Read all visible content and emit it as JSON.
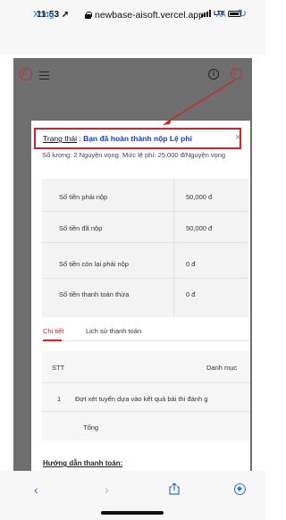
{
  "status_bar": {
    "time": "11:53",
    "carrier": "LTE"
  },
  "browser": {
    "done_label": "Xong",
    "url": "newbase-aisoft.vercel.app",
    "text_size_label": "AA"
  },
  "modal": {
    "status_key": "Trạng thái",
    "status_sep": " : ",
    "status_value": "Bạn đã hoàn thành nộp Lệ phí",
    "close_label": "×",
    "summary": "Số lượng: 2 Nguyện vọng. Mức lệ phí: 25,000 đ/Nguyện vọng",
    "fees": [
      {
        "label": "Số tiền phải nộp",
        "value": "50,000 đ"
      },
      {
        "label": "Số tiền đã nộp",
        "value": "50,000 đ"
      },
      {
        "label": "Số tiền còn lại phải nộp",
        "value": "0 đ"
      },
      {
        "label": "Số tiền thanh toán thừa",
        "value": "0 đ"
      }
    ],
    "tabs": {
      "detail": "Chi tiết",
      "history": "Lịch sử thanh toán"
    },
    "detail_table": {
      "header_stt": "STT",
      "header_category": "Danh mục",
      "row1_stt": "1",
      "row1_desc": "Đợt xét tuyển dựa vào kết quả bài thi đánh g",
      "total_label": "Tổng"
    },
    "guide_title": "Hướng dẫn thanh toán:"
  },
  "colors": {
    "accent_red": "#d62222",
    "status_blue": "#1a3cc8",
    "ios_blue": "#2a6fdb"
  }
}
